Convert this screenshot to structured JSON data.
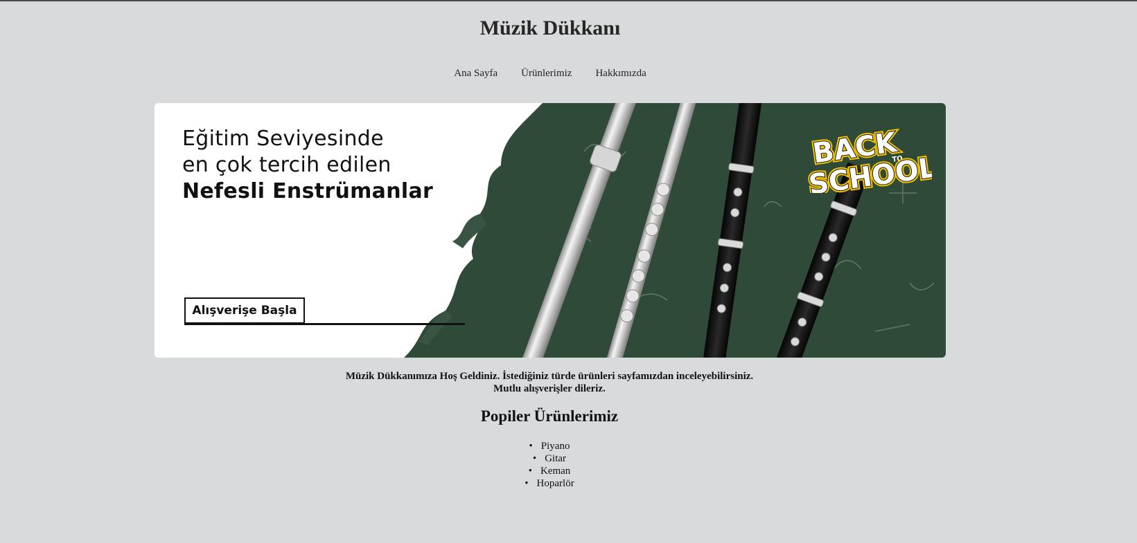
{
  "site": {
    "title": "Müzik Dükkanı"
  },
  "nav": {
    "items": [
      {
        "label": "Ana Sayfa"
      },
      {
        "label": "Ürünlerimiz"
      },
      {
        "label": "Hakkımızda"
      }
    ]
  },
  "banner": {
    "line1": "Eğitim Seviyesinde",
    "line2": "en çok tercih edilen",
    "line3": "Nefesli Enstrümanlar",
    "button_label": "Alışverişe Başla",
    "badge_top": "BACK",
    "badge_mid": "TO",
    "badge_bottom": "SCHOOL"
  },
  "welcome": {
    "line1": "Müzik Dükkanımıza Hoş Geldiniz. İstediğiniz türde ürünleri sayfamızdan inceleyebilirsiniz.",
    "line2": "Mutlu alışverişler dileriz."
  },
  "popular": {
    "title": "Popiler Ürünlerimiz",
    "items": [
      "Piyano",
      "Gitar",
      "Keman",
      "Hoparlör"
    ]
  },
  "colors": {
    "page_bg": "#d9dadc",
    "chalkboard": "#2f4a38"
  }
}
